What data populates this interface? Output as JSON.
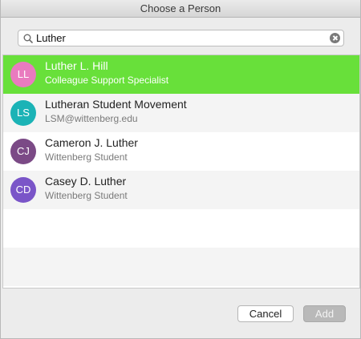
{
  "window": {
    "title": "Choose a Person"
  },
  "search": {
    "value": "Luther",
    "icon": "search-icon",
    "clear_icon": "clear-icon"
  },
  "people": [
    {
      "initials": "LL",
      "name": "Luther L. Hill",
      "subtitle": "Colleague Support Specialist",
      "avatar_color": "#e97bbf",
      "selected": true
    },
    {
      "initials": "LS",
      "name": "Lutheran Student Movement",
      "subtitle": "LSM@wittenberg.edu",
      "avatar_color": "#1bb3b6",
      "selected": false
    },
    {
      "initials": "CJ",
      "name": "Cameron J. Luther",
      "subtitle": "Wittenberg Student",
      "avatar_color": "#7b4a86",
      "selected": false
    },
    {
      "initials": "CD",
      "name": "Casey D. Luther",
      "subtitle": "Wittenberg Student",
      "avatar_color": "#7a55c8",
      "selected": false
    }
  ],
  "buttons": {
    "cancel_label": "Cancel",
    "add_label": "Add"
  },
  "colors": {
    "selection": "#68e03a"
  }
}
